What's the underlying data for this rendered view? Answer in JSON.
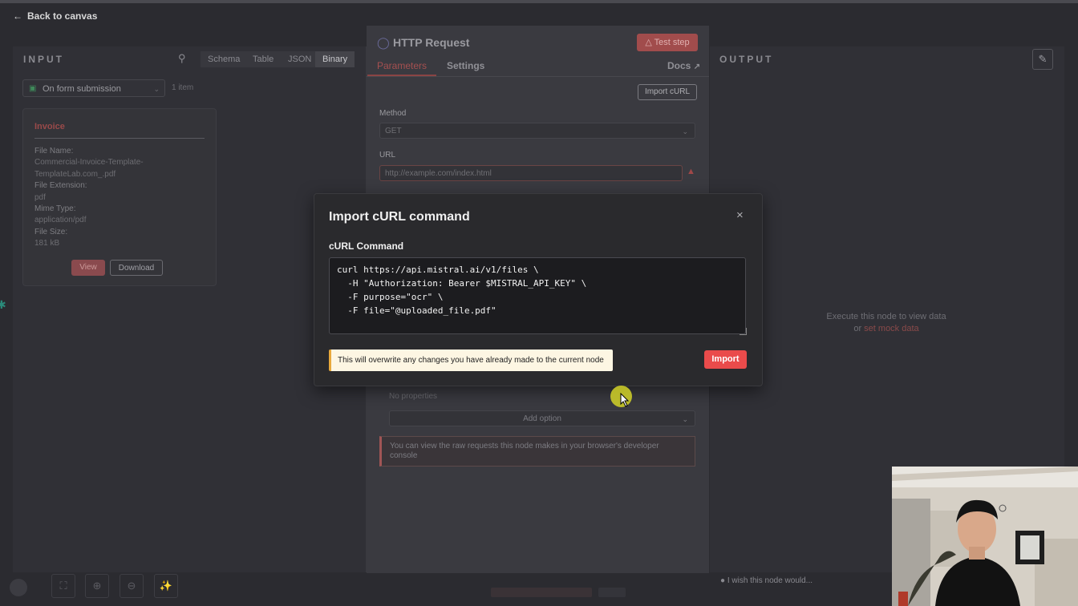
{
  "nav": {
    "back_label": "Back to canvas"
  },
  "input": {
    "title": "INPUT",
    "tabs": [
      "Schema",
      "Table",
      "JSON",
      "Binary"
    ],
    "active_tab": "Binary",
    "trigger": "On form submission",
    "item_count": "1 item",
    "card": {
      "title": "Invoice",
      "fields": [
        {
          "label": "File Name:",
          "value": "Commercial-Invoice-Template-TemplateLab.com_.pdf"
        },
        {
          "label": "File Extension:",
          "value": "pdf"
        },
        {
          "label": "Mime Type:",
          "value": "application/pdf"
        },
        {
          "label": "File Size:",
          "value": "181 kB"
        }
      ],
      "view_label": "View",
      "download_label": "Download"
    }
  },
  "node": {
    "title": "HTTP Request",
    "test_step_label": "Test step",
    "tabs": {
      "parameters": "Parameters",
      "settings": "Settings"
    },
    "docs_label": "Docs",
    "import_curl_label": "Import cURL",
    "method_label": "Method",
    "method_value": "GET",
    "url_label": "URL",
    "url_placeholder": "http://example.com/index.html",
    "no_properties": "No properties",
    "add_option_label": "Add option",
    "info_text": "You can view the raw requests this node makes in your browser's developer console"
  },
  "output": {
    "title": "OUTPUT",
    "empty_line1": "Execute this node to view data",
    "empty_or": "or",
    "mock_link": "set mock data",
    "wish_text": "I wish this node would..."
  },
  "modal": {
    "title": "Import cURL command",
    "field_label": "cURL Command",
    "curl_text": "curl https://api.mistral.ai/v1/files \\\n  -H \"Authorization: Bearer $MISTRAL_API_KEY\" \\\n  -F purpose=\"ocr\" \\\n  -F file=\"@uploaded_file.pdf\"",
    "warning": "This will overwrite any changes you have already made to the current node",
    "import_label": "Import",
    "close_label": "×"
  },
  "colors": {
    "accent": "#ea4b4b",
    "warning_bg": "#fdf6e3",
    "warning_border": "#e8a93c",
    "modal_bg": "#2a2a2d"
  }
}
